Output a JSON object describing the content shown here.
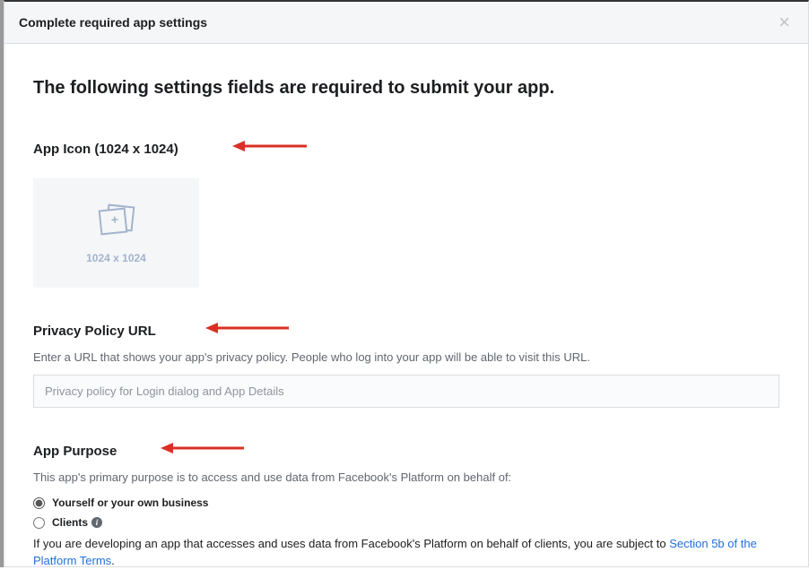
{
  "modal": {
    "title": "Complete required app settings",
    "close_label": "×"
  },
  "main_heading": "The following settings fields are required to submit your app.",
  "sections": {
    "icon": {
      "heading": "App Icon (1024 x 1024)",
      "upload_hint": "1024 x 1024"
    },
    "privacy": {
      "heading": "Privacy Policy URL",
      "desc": "Enter a URL that shows your app's privacy policy. People who log into your app will be able to visit this URL.",
      "placeholder": "Privacy policy for Login dialog and App Details"
    },
    "purpose": {
      "heading": "App Purpose",
      "desc": "This app's primary purpose is to access and use data from Facebook's Platform on behalf of:",
      "options": {
        "self": "Yourself or your own business",
        "clients": "Clients"
      },
      "footnote_pre": "If you are developing an app that accesses and uses data from Facebook's Platform on behalf of clients, you are subject to ",
      "footnote_link": "Section 5b of the Platform Terms",
      "footnote_post": "."
    }
  }
}
